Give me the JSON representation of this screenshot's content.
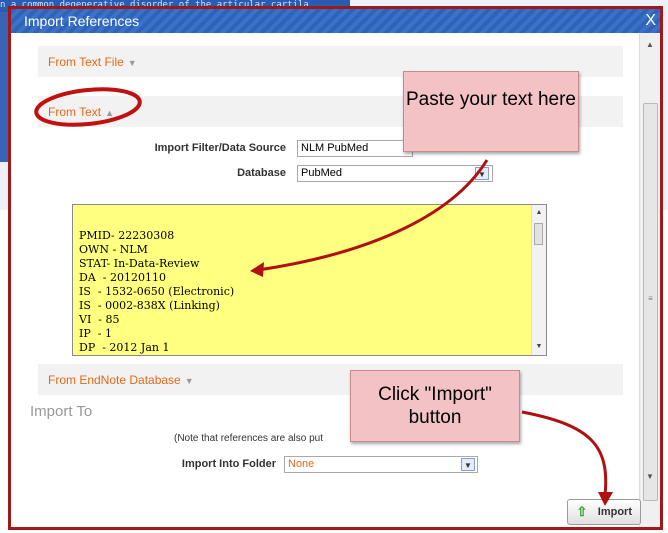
{
  "background": {
    "snippet": "n a common degenerative disorder of the articular cartila"
  },
  "dialog": {
    "title": "Import References",
    "close_label": "X"
  },
  "sections": {
    "from_text_file": "From Text File",
    "from_text": "From Text",
    "from_endnote": "From EndNote Database"
  },
  "form": {
    "filter_label": "Import Filter/Data Source",
    "filter_value": "NLM PubMed",
    "database_label": "Database",
    "database_value": "PubMed"
  },
  "pasted_text": {
    "lines": [
      "PMID- 22230308",
      "OWN - NLM",
      "STAT- In-Data-Review",
      "DA  - 20120110",
      "IS  - 1532-0650 (Electronic)",
      "IS  - 0002-838X (Linking)",
      "VI  - 85",
      "IP  - 1",
      "DP  - 2012 Jan 1"
    ]
  },
  "import_to": {
    "heading": "Import To",
    "note": "(Note that references are also put",
    "folder_label": "Import Into Folder",
    "folder_value": "None"
  },
  "import_button": {
    "label": "Import"
  },
  "callouts": {
    "paste": "Paste your text here",
    "click": "Click \"Import\" button"
  },
  "colors": {
    "title_bar": "#2e63b8",
    "dialog_border": "#a01818",
    "section_link": "#e06a1a",
    "pasted_bg": "#ffff80",
    "callout_bg": "#f2c2c4",
    "annotation": "#c01010"
  }
}
